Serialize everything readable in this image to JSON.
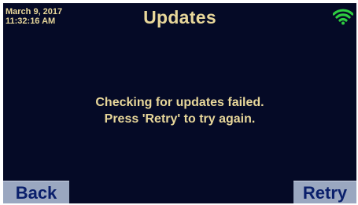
{
  "status_bar": {
    "date": "March 9, 2017",
    "time": "11:32:16 AM",
    "wifi_icon": "wifi-icon",
    "wifi_color": "#2ecc40"
  },
  "header": {
    "title": "Updates"
  },
  "message": {
    "line1": "Checking for updates failed.",
    "line2": "Press 'Retry' to try again."
  },
  "buttons": {
    "back_label": "Back",
    "retry_label": "Retry"
  },
  "colors": {
    "background": "#050a26",
    "text": "#e8d79a",
    "button_bg": "#9aa7c0",
    "button_text": "#0a1f6b"
  }
}
